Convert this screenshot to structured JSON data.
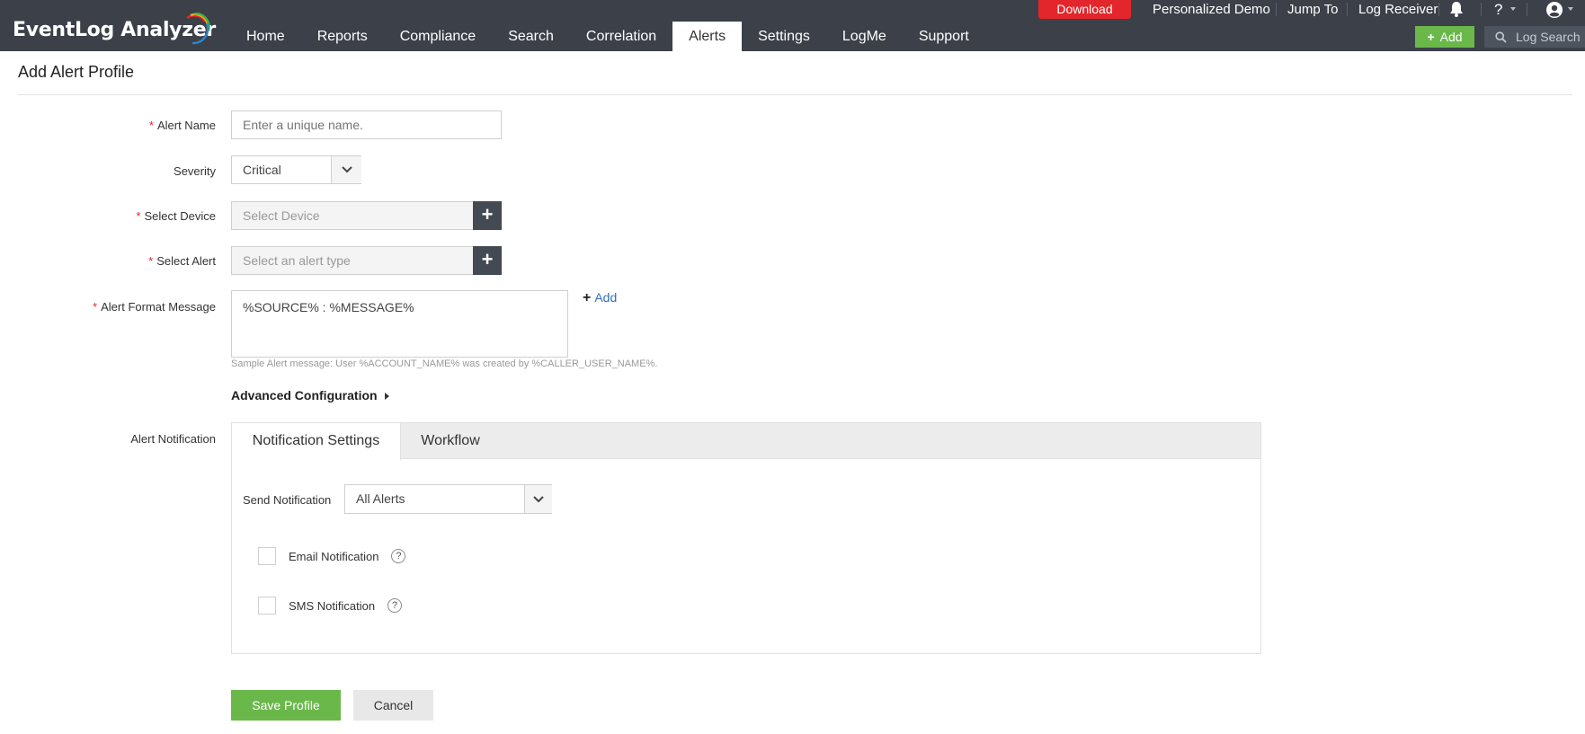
{
  "app": {
    "title": "EventLog Analyzer",
    "brand_colors": [
      "#e2262b",
      "#f6a623",
      "#3fae49",
      "#2f86c8"
    ]
  },
  "nav": {
    "items": [
      {
        "label": "Home"
      },
      {
        "label": "Reports"
      },
      {
        "label": "Compliance"
      },
      {
        "label": "Search"
      },
      {
        "label": "Correlation"
      },
      {
        "label": "Alerts",
        "active": true
      },
      {
        "label": "Settings"
      },
      {
        "label": "LogMe"
      },
      {
        "label": "Support"
      }
    ]
  },
  "topbar": {
    "download_label": "Download",
    "personalized_demo": "Personalized Demo",
    "jump_to": "Jump To",
    "log_receiver": "Log Receiver",
    "help_label": "?",
    "add_label": "Add",
    "search_placeholder": "Log Search",
    "icons": [
      "bell-icon",
      "help-icon",
      "user-icon",
      "search-icon"
    ]
  },
  "page": {
    "title": "Add Alert Profile"
  },
  "form": {
    "alert_name": {
      "label": "Alert Name",
      "placeholder": "Enter a unique name.",
      "required": true
    },
    "severity": {
      "label": "Severity",
      "value": "Critical"
    },
    "select_device": {
      "label": "Select Device",
      "placeholder": "Select Device",
      "required": true
    },
    "select_alert": {
      "label": "Select Alert",
      "placeholder": "Select an alert type",
      "required": true
    },
    "alert_format_message": {
      "label": "Alert Format Message",
      "value": "%SOURCE% : %MESSAGE%",
      "required": true,
      "add_label": "Add",
      "hint": "Sample Alert message: User %ACCOUNT_NAME% was created by %CALLER_USER_NAME%."
    },
    "advanced_configuration": "Advanced Configuration",
    "alert_notification_label": "Alert Notification"
  },
  "notification": {
    "tabs": [
      {
        "label": "Notification Settings",
        "active": true
      },
      {
        "label": "Workflow"
      }
    ],
    "send_notification_label": "Send Notification",
    "send_notification_value": "All Alerts",
    "email_label": "Email Notification",
    "sms_label": "SMS Notification",
    "help_mark": "?"
  },
  "actions": {
    "save_label": "Save Profile",
    "cancel_label": "Cancel"
  }
}
